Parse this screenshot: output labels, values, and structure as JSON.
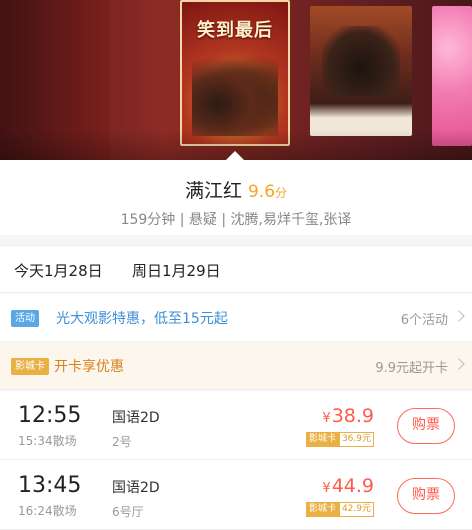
{
  "carousel": {
    "active_poster_title": "笑到最后",
    "posters": [
      "poster-1-partial",
      "满江红",
      "poster-3",
      "poster-4-partial"
    ]
  },
  "movie": {
    "title": "满江红",
    "score": "9.6",
    "score_unit": "分",
    "meta": "159分钟 | 悬疑 | 沈腾,易烊千玺,张译"
  },
  "date_tabs": [
    {
      "label": "今天1月28日"
    },
    {
      "label": "周日1月29日"
    }
  ],
  "promos": [
    {
      "tag": "活动",
      "text": "光大观影特惠，低至15元起",
      "right": "6个活动",
      "tag_color": "#5aa7e6",
      "text_color": "#3d8fd6"
    },
    {
      "tag": "影城卡",
      "text": "开卡享优惠",
      "right": "9.9元起开卡",
      "tag_color": "#e9b144",
      "text_color": "#d9811f"
    }
  ],
  "showtimes": [
    {
      "start": "12:55",
      "end": "15:34散场",
      "lang": "国语2D",
      "hall": "2号",
      "price_symbol": "¥",
      "price": "38.9",
      "card_label": "影城卡",
      "card_price": "36.9元",
      "buy": "购票"
    },
    {
      "start": "13:45",
      "end": "16:24散场",
      "lang": "国语2D",
      "hall": "6号厅",
      "price_symbol": "¥",
      "price": "44.9",
      "card_label": "影城卡",
      "card_price": "42.9元",
      "buy": "购票"
    }
  ],
  "colors": {
    "accent_red": "#ff5a4a",
    "score_gold": "#f5a623",
    "promo_blue": "#3d8fd6",
    "promo_gold": "#d9811f"
  }
}
